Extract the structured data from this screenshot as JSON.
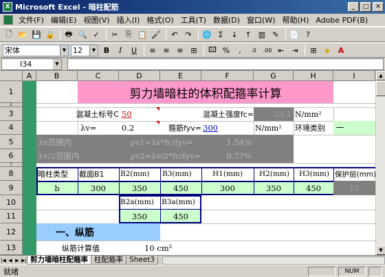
{
  "window": {
    "title": "Microsoft Excel - 暗柱配筋",
    "app_icon": "X"
  },
  "menu": [
    "文件(F)",
    "编辑(E)",
    "视图(V)",
    "插入(I)",
    "格式(O)",
    "工具(T)",
    "数据(D)",
    "窗口(W)",
    "帮助(H)",
    "Adobe PDF(B)"
  ],
  "format": {
    "font": "宋体",
    "size": "12"
  },
  "namebox": "I34",
  "columns": [
    "A",
    "B",
    "C",
    "D",
    "E",
    "F",
    "G",
    "H",
    "I"
  ],
  "rows": [
    "1",
    "2",
    "3",
    "4",
    "5",
    "6",
    "7",
    "8",
    "9",
    "10",
    "11",
    "12",
    "13"
  ],
  "cells": {
    "title": "剪力墙暗柱的体积配箍率计算",
    "r3_label1": "混凝土标号C",
    "r3_val1": "50",
    "r3_label2": "混凝土强度fc=",
    "r3_val2": "23.1",
    "r3_unit": "N/mm²",
    "r4_label1": "λv=",
    "r4_val1": "0.2",
    "r4_label2": "箍筋fyv=",
    "r4_val2": "300",
    "r4_unit": "N/mm²",
    "r4_label3": "环境类别",
    "r4_val3": "一",
    "r5_label": "λv范围内",
    "r5_formula": "ρv1=λv*fc/fyv=",
    "r5_val": "1.54%",
    "r6_label": "λv/2范围内",
    "r6_formula": "ρv2=λv/2*fc/fyv=",
    "r6_val": "0.77%",
    "r8_headers": [
      "暗柱类型",
      "截面B1",
      "B2(mm)",
      "B3(mm)",
      "H1(mm)",
      "H2(mm)",
      "H3(mm)",
      "保护层(mm)"
    ],
    "r9_values": [
      "b",
      "300",
      "350",
      "450",
      "300",
      "350",
      "450",
      "15"
    ],
    "r10_headers": [
      "B2a(mm)",
      "B3a(mm)"
    ],
    "r11_values": [
      "350",
      "450"
    ],
    "r12_section": "一、纵筋",
    "r13_label": "纵筋计算值",
    "r13_val": "10 cm²"
  },
  "sheets": [
    "剪力墙暗柱配箍率",
    "柱配箍率",
    "Sheet3"
  ],
  "status": {
    "ready": "就绪",
    "num": "NUM"
  },
  "colors": {
    "title_bg": "#ff99cc",
    "gray_bg": "#808080",
    "header_fill": "#ccffcc",
    "border_blue": "#000080",
    "section_bg": "#99ccff"
  }
}
